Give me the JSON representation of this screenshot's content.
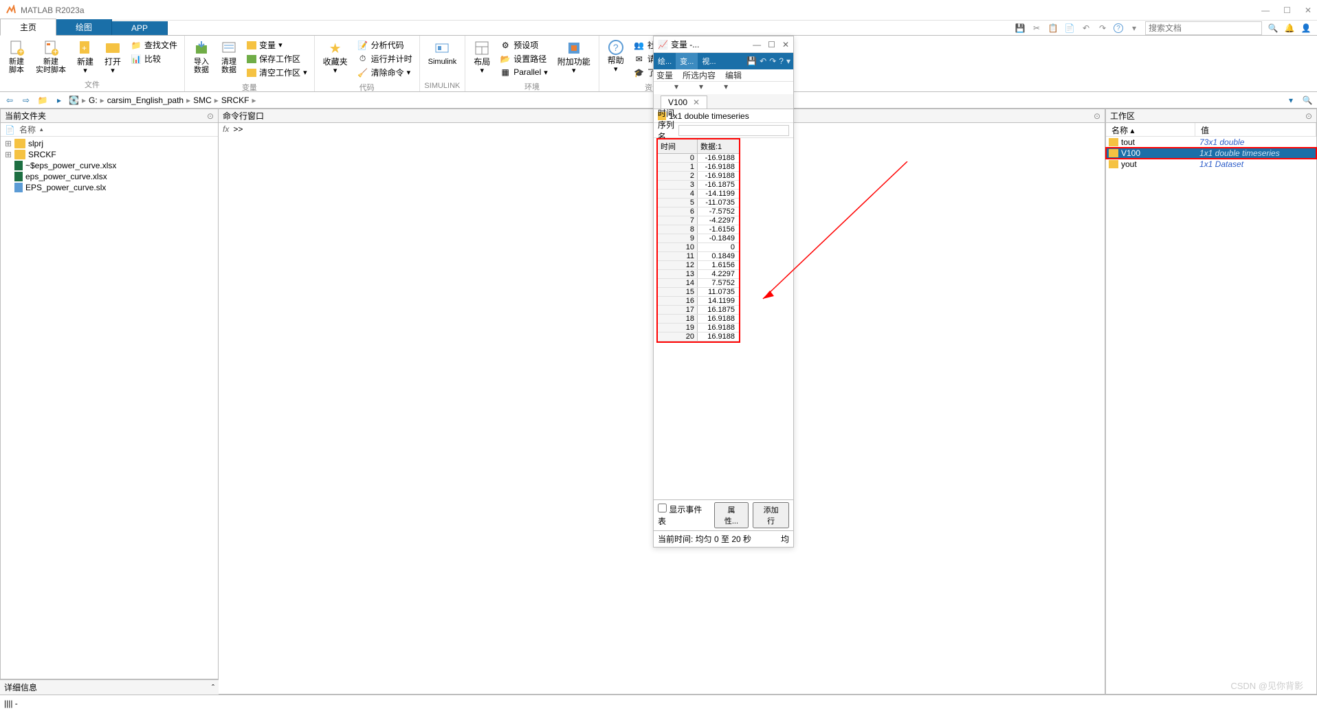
{
  "titlebar": {
    "title": "MATLAB R2023a"
  },
  "tabs": {
    "home": "主页",
    "plots": "绘图",
    "apps": "APP"
  },
  "searchdoc_placeholder": "搜索文档",
  "toolstrip": {
    "file": {
      "label": "文件",
      "new_script": "新建\n脚本",
      "new_live": "新建\n实时脚本",
      "new": "新建",
      "open": "打开",
      "find_files": "查找文件",
      "compare": "比较"
    },
    "variable": {
      "label": "变量",
      "import": "导入\n数据",
      "clean": "清理\n数据",
      "var": "变量",
      "save_ws": "保存工作区",
      "clear_ws": "清空工作区"
    },
    "code": {
      "label": "代码",
      "fav": "收藏夹",
      "analyze": "分析代码",
      "runtime": "运行并计时",
      "clear_cmd": "清除命令"
    },
    "simulink": {
      "label": "SIMULINK",
      "btn": "Simulink"
    },
    "env": {
      "label": "环境",
      "layout": "布局",
      "prefs": "预设项",
      "setpath": "设置路径",
      "parallel": "Parallel",
      "addons": "附加功能"
    },
    "res": {
      "label": "资源",
      "help": "帮助",
      "community": "社区",
      "support": "请求支持",
      "learn": "了解 MATLAB"
    }
  },
  "path": {
    "drive": "G:",
    "segs": [
      "carsim_English_path",
      "SMC",
      "SRCKF"
    ]
  },
  "left_panel": {
    "title": "当前文件夹",
    "col_name": "名称",
    "files": [
      {
        "name": "slprj",
        "type": "folder",
        "expandable": true
      },
      {
        "name": "SRCKF",
        "type": "folder",
        "expandable": true
      },
      {
        "name": "~$eps_power_curve.xlsx",
        "type": "xlsx"
      },
      {
        "name": "eps_power_curve.xlsx",
        "type": "xlsx"
      },
      {
        "name": "EPS_power_curve.slx",
        "type": "slx"
      }
    ],
    "details": "详细信息"
  },
  "cmdwin": {
    "title": "命令行窗口",
    "fx": "fx",
    "prompt": ">>"
  },
  "varpop": {
    "title": "变量 -...",
    "tabs": [
      "绘...",
      "变...",
      "视..."
    ],
    "labels": [
      "变量",
      "所选内容",
      "编辑"
    ],
    "file_tab": "V100",
    "typeinfo": "1x1 double timeseries",
    "ts_name_label": "时间序列名称:",
    "col_time": "时间",
    "col_data": "数据:1",
    "rows": [
      {
        "t": "0",
        "v": "-16.9188"
      },
      {
        "t": "1",
        "v": "-16.9188"
      },
      {
        "t": "2",
        "v": "-16.9188"
      },
      {
        "t": "3",
        "v": "-16.1875"
      },
      {
        "t": "4",
        "v": "-14.1199"
      },
      {
        "t": "5",
        "v": "-11.0735"
      },
      {
        "t": "6",
        "v": "-7.5752"
      },
      {
        "t": "7",
        "v": "-4.2297"
      },
      {
        "t": "8",
        "v": "-1.6156"
      },
      {
        "t": "9",
        "v": "-0.1849"
      },
      {
        "t": "10",
        "v": "0"
      },
      {
        "t": "11",
        "v": "0.1849"
      },
      {
        "t": "12",
        "v": "1.6156"
      },
      {
        "t": "13",
        "v": "4.2297"
      },
      {
        "t": "14",
        "v": "7.5752"
      },
      {
        "t": "15",
        "v": "11.0735"
      },
      {
        "t": "16",
        "v": "14.1199"
      },
      {
        "t": "17",
        "v": "16.1875"
      },
      {
        "t": "18",
        "v": "16.9188"
      },
      {
        "t": "19",
        "v": "16.9188"
      },
      {
        "t": "20",
        "v": "16.9188"
      }
    ],
    "show_event": "显示事件表",
    "props_btn": "属性...",
    "addrow_btn": "添加行",
    "cur_time": "当前时间: 均匀 0 至 20 秒",
    "uniform": "均"
  },
  "workspace": {
    "title": "工作区",
    "col_name": "名称",
    "col_value": "值",
    "vars": [
      {
        "name": "tout",
        "value": "73x1 double",
        "sel": false,
        "hl": false
      },
      {
        "name": "V100",
        "value": "1x1 double timeseries",
        "sel": true,
        "hl": true
      },
      {
        "name": "yout",
        "value": "1x1 Dataset",
        "sel": false,
        "hl": false
      }
    ]
  },
  "statusbar": {
    "text": "|||| -"
  },
  "watermark": "CSDN @见你背影"
}
